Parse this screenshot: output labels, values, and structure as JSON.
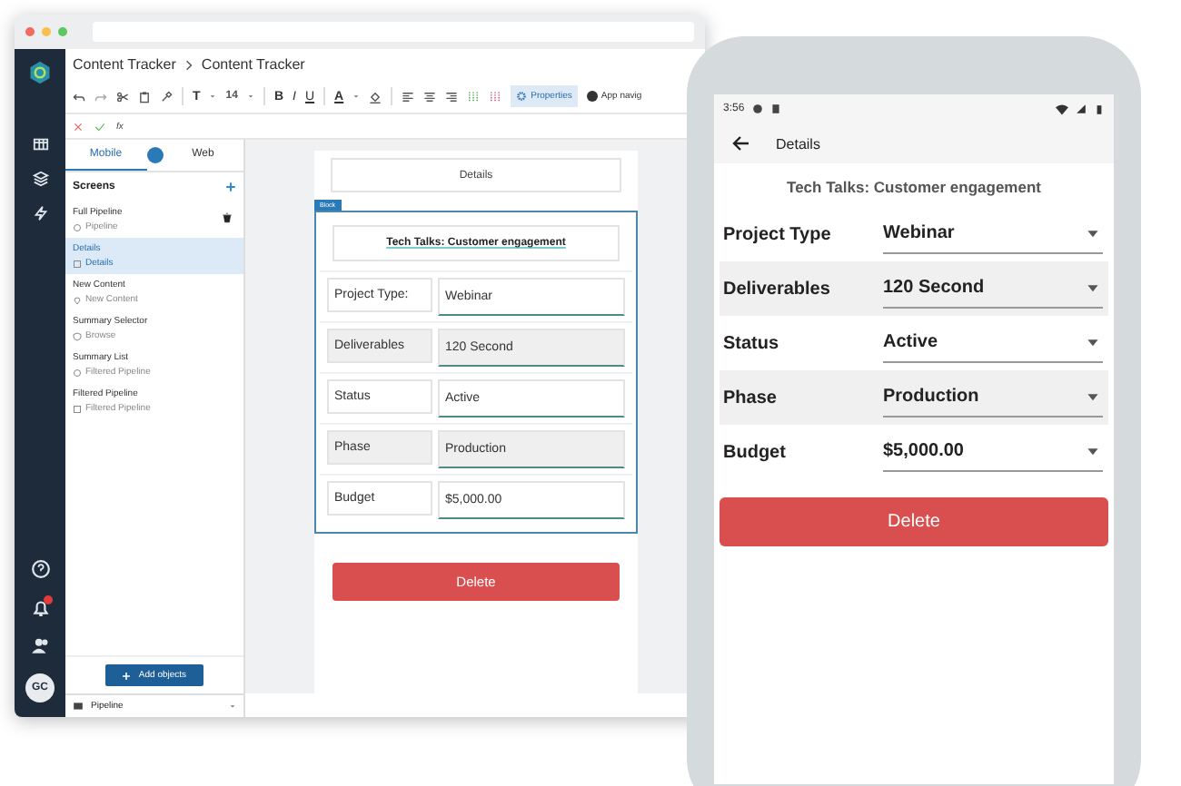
{
  "window": {
    "breadcrumb": [
      "Content Tracker",
      "Content Tracker"
    ]
  },
  "toolbar": {
    "font_button": "T",
    "font_size": "14",
    "bold": "B",
    "italic": "I",
    "underline": "U",
    "text_color": "A",
    "properties": "Properties",
    "app_navigation": "App navig"
  },
  "formula_bar": {
    "fx": "fx"
  },
  "rail": {
    "avatar": "GC"
  },
  "left_panel": {
    "tabs": [
      {
        "label": "Mobile",
        "selected": true
      },
      {
        "label": "Web",
        "selected": false
      }
    ],
    "screens_heading": "Screens",
    "screens": [
      {
        "title": "Full Pipeline",
        "subtitle": "Pipeline",
        "kind": "circle",
        "selected": false,
        "trash": true
      },
      {
        "title": "Details",
        "subtitle": "Details",
        "kind": "square",
        "selected": true,
        "trash": false
      },
      {
        "title": "New Content",
        "subtitle": "New Content",
        "kind": "pin",
        "selected": false,
        "trash": false
      },
      {
        "title": "Summary Selector",
        "subtitle": "Browse",
        "kind": "shield",
        "selected": false,
        "trash": false
      },
      {
        "title": "Summary List",
        "subtitle": "Filtered Pipeline",
        "kind": "circle",
        "selected": false,
        "trash": false
      },
      {
        "title": "Filtered Pipeline",
        "subtitle": "Filtered Pipeline",
        "kind": "square",
        "selected": false,
        "trash": false
      }
    ],
    "add_button": "Add objects",
    "data_source": "Pipeline"
  },
  "canvas": {
    "header": "Details",
    "block_tag": "Block",
    "title": "Tech Talks: Customer engagement",
    "rows": [
      {
        "label": "Project Type:",
        "value": "Webinar",
        "shaded": false
      },
      {
        "label": "Deliverables",
        "value": "120 Second",
        "shaded": true
      },
      {
        "label": "Status",
        "value": "Active",
        "shaded": false
      },
      {
        "label": "Phase",
        "value": "Production",
        "shaded": true
      },
      {
        "label": "Budget",
        "value": "$5,000.00",
        "shaded": false
      }
    ],
    "delete": "Delete"
  },
  "phone": {
    "time": "3:56",
    "title": "Details",
    "subtitle": "Tech Talks: Customer engagement",
    "rows": [
      {
        "label": "Project Type",
        "value": "Webinar",
        "shaded": false
      },
      {
        "label": "Deliverables",
        "value": "120 Second",
        "shaded": true
      },
      {
        "label": "Status",
        "value": "Active",
        "shaded": false
      },
      {
        "label": "Phase",
        "value": "Production",
        "shaded": true
      },
      {
        "label": "Budget",
        "value": "$5,000.00",
        "shaded": false
      }
    ],
    "delete": "Delete"
  }
}
